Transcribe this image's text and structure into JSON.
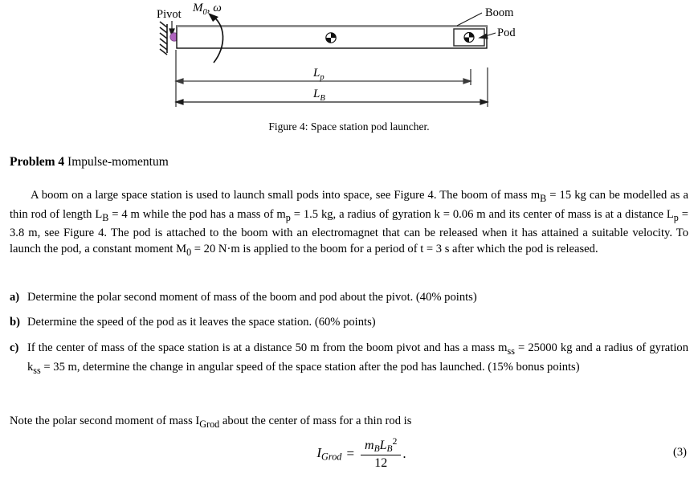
{
  "figure": {
    "labels": {
      "pivot": "Pivot",
      "boom": "Boom",
      "pod": "Pod",
      "moment_symbol": "M",
      "moment_sub": "0",
      "moment_omega": ", ω",
      "lp_symbol": "L",
      "lp_sub": "p",
      "lb_symbol": "L",
      "lb_sub": "B"
    },
    "caption": "Figure 4: Space station pod launcher.",
    "colors": {
      "pivot_dot": "#b064bf",
      "boom_outline": "#000000",
      "boom_top_edge": "#808080",
      "dimension_line": "#404040",
      "com_marker": "#000000"
    }
  },
  "problem": {
    "heading_bold": "Problem 4",
    "heading_rest": "Impulse-momentum",
    "paragraph": "A boom on a large space station is used to launch small pods into space, see Figure 4. The boom of mass m<sub>B</sub> = 15 kg can be modelled as a thin rod of length L<sub>B</sub> = 4 m while the pod has a mass of m<sub>p</sub> = 1.5 kg, a radius of gyration k = 0.06 m and its center of mass is at a distance L<sub>p</sub> = 3.8 m, see Figure 4. The pod is attached to the boom with an electromagnet that can be released when it has attained a suitable velocity. To launch the pod, a constant moment M<sub>0</sub> = 20 N·m is applied to the boom for a period of t = 3 s after which the pod is released.",
    "items": [
      {
        "label": "a)",
        "text": "Determine the polar second moment of mass of the boom and pod about the pivot. (40% points)"
      },
      {
        "label": "b)",
        "text": "Determine the speed of the pod as it leaves the space station. (60% points)"
      },
      {
        "label": "c)",
        "text": "If the center of mass of the space station is at a distance 50 m from the boom pivot and has a mass m<sub>ss</sub> = 25000 kg and a radius of gyration k<sub>ss</sub> = 35 m, determine the change in angular speed of the space station after the pod has launched. (15% bonus points)"
      }
    ],
    "note": "Note the polar second moment of mass I<sub>Grod</sub> about the center of mass for a thin rod is",
    "equation": {
      "lhs_symbol": "I",
      "lhs_sub": "Grod",
      "equals": "=",
      "numerator_m": "m",
      "numerator_m_sub": "B",
      "numerator_L": "L",
      "numerator_L_sub": "B",
      "numerator_L_sup": "2",
      "denominator": "12",
      "trailing_punctuation": ".",
      "number": "(3)"
    },
    "values": {
      "m_B": "15 kg",
      "L_B": "4 m",
      "m_p": "1.5 kg",
      "k": "0.06 m",
      "L_p": "3.8 m",
      "M_0": "20 N·m",
      "t": "3 s",
      "ss_distance": "50 m",
      "m_ss": "25000 kg",
      "k_ss": "35 m"
    }
  }
}
